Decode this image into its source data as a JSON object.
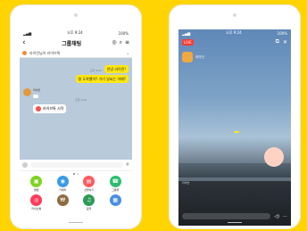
{
  "status_bar": {
    "time": "오후 9:24",
    "battery": "100%"
  },
  "left": {
    "header": {
      "title": "그룹채팅"
    },
    "notice": {
      "text": "라이언님이 라이브톡"
    },
    "messages": [
      {
        "text": "안녕 라이언!"
      },
      {
        "text": "잘 도착했어? 거기 날씨는 어때?"
      }
    ],
    "sender": "라이언",
    "status_text": "",
    "live_pill": "라이브톡 시작",
    "timestamps": [
      "오후 9:24",
      "오후 9:24"
    ],
    "grid": [
      {
        "label": "앨범",
        "color": "#7ed321",
        "icon": "album-icon",
        "glyph": "▣"
      },
      {
        "label": "카메라",
        "color": "#3b9ce8",
        "icon": "camera-icon",
        "glyph": "◉"
      },
      {
        "label": "선물하기",
        "color": "#ff5a5f",
        "icon": "gift-icon",
        "glyph": "▤"
      },
      {
        "label": "그룹콜",
        "color": "#2dbd6e",
        "icon": "call-icon",
        "glyph": "☎"
      },
      {
        "label": "라이브톡",
        "color": "#ff3b5c",
        "icon": "live-icon",
        "glyph": "◎"
      },
      {
        "label": "",
        "color": "#8e6b3f",
        "icon": "money-icon",
        "glyph": "₩"
      },
      {
        "label": "음악",
        "color": "#2e9a56",
        "icon": "music-icon",
        "glyph": "♫"
      },
      {
        "label": "",
        "color": "#4a8fe2",
        "icon": "calendar-icon",
        "glyph": "▦"
      }
    ]
  },
  "right": {
    "live_badge": "LIVE",
    "streamer_name": "라이언",
    "streamer_sub": "",
    "yellow_bubble": "",
    "comments": [
      {
        "name": "라이언",
        "text": ""
      },
      {
        "name": "",
        "text": ""
      },
      {
        "name": "",
        "text": ""
      }
    ],
    "input_placeholder": ""
  }
}
